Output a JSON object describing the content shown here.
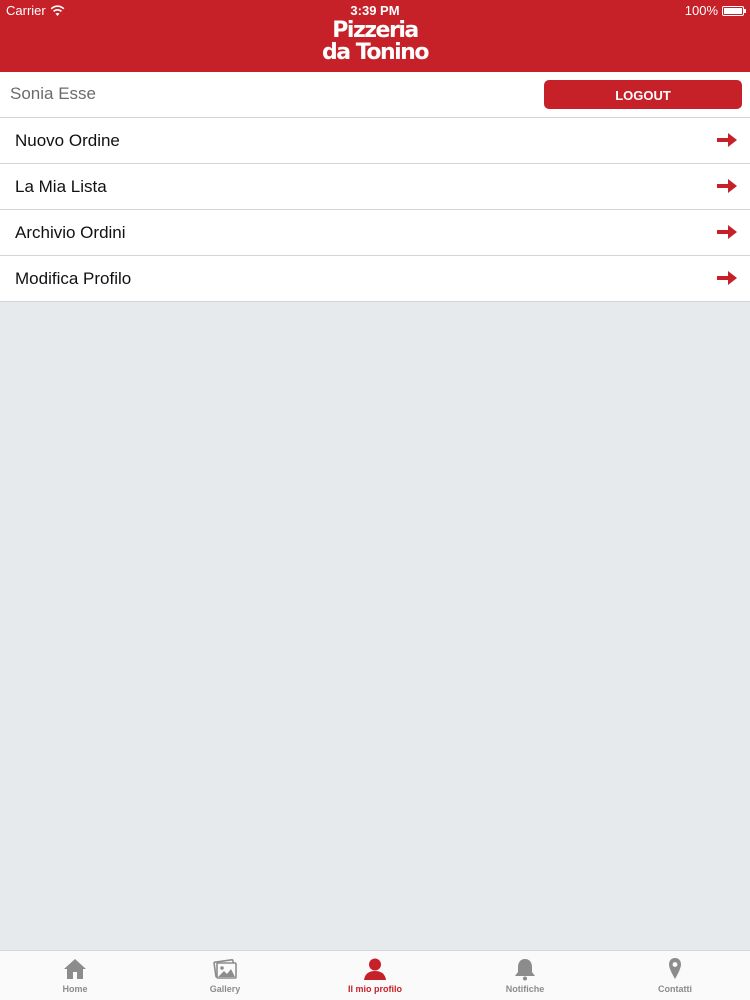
{
  "status_bar": {
    "carrier": "Carrier",
    "time": "3:39 PM",
    "battery": "100%"
  },
  "header": {
    "logo_line1": "Pizzeria",
    "logo_line2": "da Tonino"
  },
  "user_bar": {
    "user_name": "Sonia Esse",
    "logout_label": "LOGOUT"
  },
  "menu": {
    "items": [
      {
        "label": "Nuovo Ordine"
      },
      {
        "label": "La Mia Lista"
      },
      {
        "label": "Archivio Ordini"
      },
      {
        "label": "Modifica Profilo"
      }
    ]
  },
  "tabbar": {
    "tabs": [
      {
        "label": "Home",
        "icon": "home-icon"
      },
      {
        "label": "Gallery",
        "icon": "gallery-icon"
      },
      {
        "label": "Il mio profilo",
        "icon": "profile-icon",
        "active": true
      },
      {
        "label": "Notifiche",
        "icon": "bell-icon"
      },
      {
        "label": "Contatti",
        "icon": "map-pin-icon"
      }
    ]
  },
  "colors": {
    "brand_red": "#c62129",
    "background": "#e6eaec",
    "inactive_tab": "#8c8c8c"
  }
}
